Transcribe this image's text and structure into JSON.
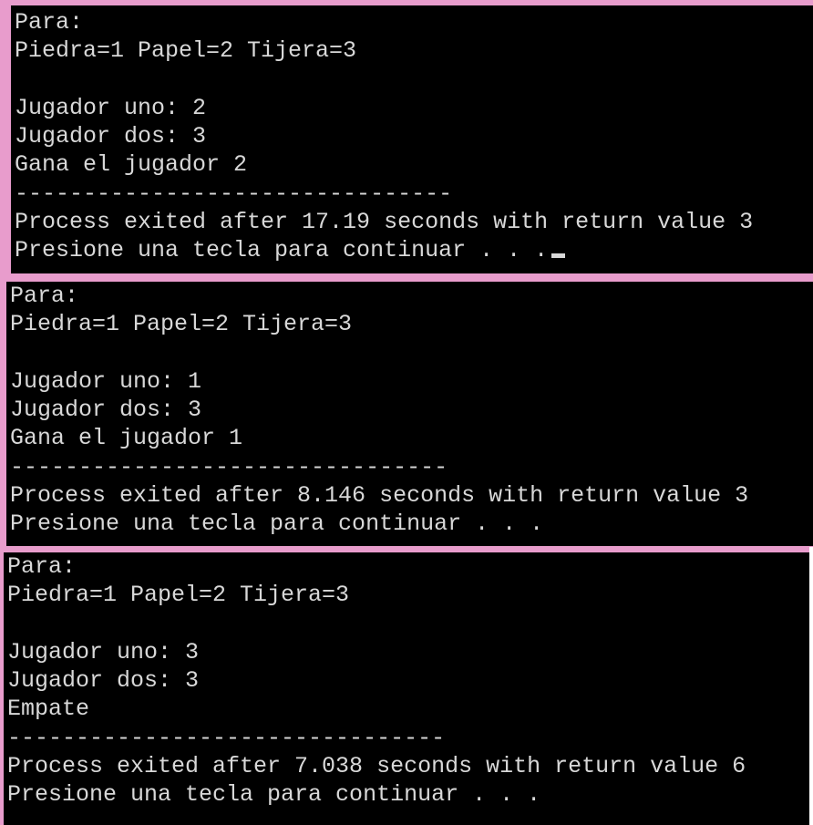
{
  "runs": [
    {
      "lines": [
        "Para:",
        "Piedra=1 Papel=2 Tijera=3",
        "",
        "Jugador uno: 2",
        "Jugador dos: 3",
        "Gana el jugador 2",
        "--------------------------------",
        "Process exited after 17.19 seconds with return value 3",
        "Presione una tecla para continuar . . ."
      ],
      "cursor": true
    },
    {
      "lines": [
        "Para:",
        "Piedra=1 Papel=2 Tijera=3",
        "",
        "Jugador uno: 1",
        "Jugador dos: 3",
        "Gana el jugador 1",
        "--------------------------------",
        "Process exited after 8.146 seconds with return value 3",
        "Presione una tecla para continuar . . ."
      ],
      "cursor": false
    },
    {
      "lines": [
        "Para:",
        "Piedra=1 Papel=2 Tijera=3",
        "",
        "Jugador uno: 3",
        "Jugador dos: 3",
        "Empate",
        "--------------------------------",
        "Process exited after 7.038 seconds with return value 6",
        "Presione una tecla para continuar . . ."
      ],
      "cursor": false
    }
  ],
  "colors": {
    "border": "#e89ccc",
    "background": "#000000",
    "text": "#d8d8d8"
  }
}
